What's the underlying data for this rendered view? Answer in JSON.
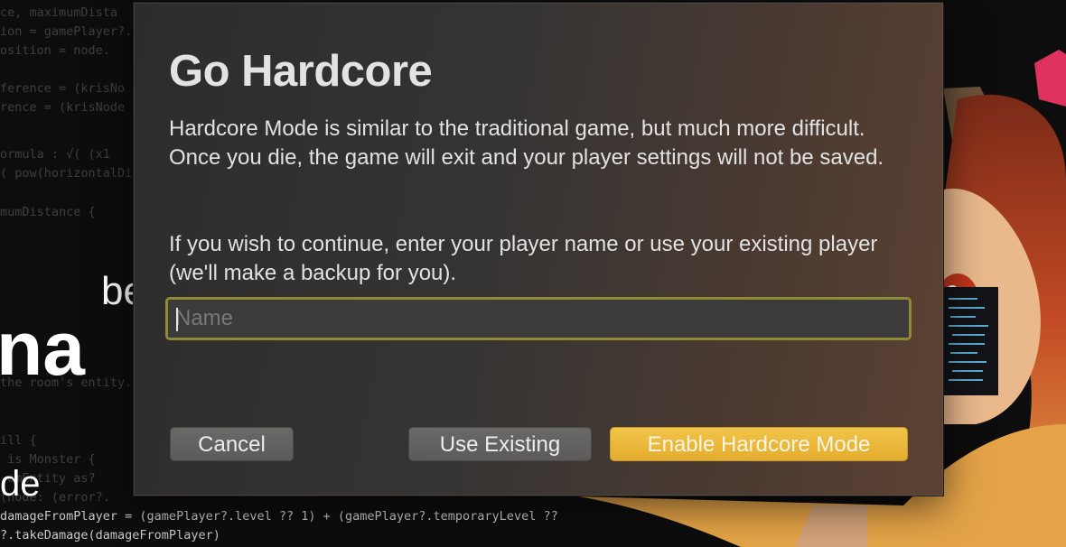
{
  "background": {
    "code_lines": [
      "ce, maximumDista",
      "ion = gamePlayer?.",
      "osition = node.",
      "",
      "ference = (krisNo",
      "rence = (krisNode",
      "",
      "ormula : √( (x1",
      "( pow(horizontalDi",
      "",
      "mumDistance {"
    ],
    "code_lines_bottom": [
      "the room's entity.",
      "",
      "",
      "ill {",
      " is Monster {",
      " omEntity as?",
      "(node: (error?.",
      "damageFromPlayer = (gamePlayer?.level ?? 1) + (gamePlayer?.temporaryLevel ??",
      "?.takeDamage(damageFromPlayer)"
    ],
    "words": {
      "w1": "be",
      "w2": "na",
      "w3": "de"
    },
    "colors": {
      "hair": "#c8502a",
      "accent": "#e2a13a"
    }
  },
  "dialog": {
    "title": "Go Hardcore",
    "paragraph1": "Hardcore Mode is similar to the traditional game, but much more difficult. Once you die, the game will exit and your player settings will not be saved.",
    "paragraph2": "If you wish to continue, enter your player name or use your existing player (we'll make a backup for you).",
    "name_field": {
      "placeholder": "Name",
      "value": ""
    },
    "buttons": {
      "cancel": "Cancel",
      "use_existing": "Use Existing",
      "enable": "Enable Hardcore Mode"
    },
    "colors": {
      "primary_button": "#e9b53a",
      "focus_ring": "#8f8a35"
    }
  }
}
